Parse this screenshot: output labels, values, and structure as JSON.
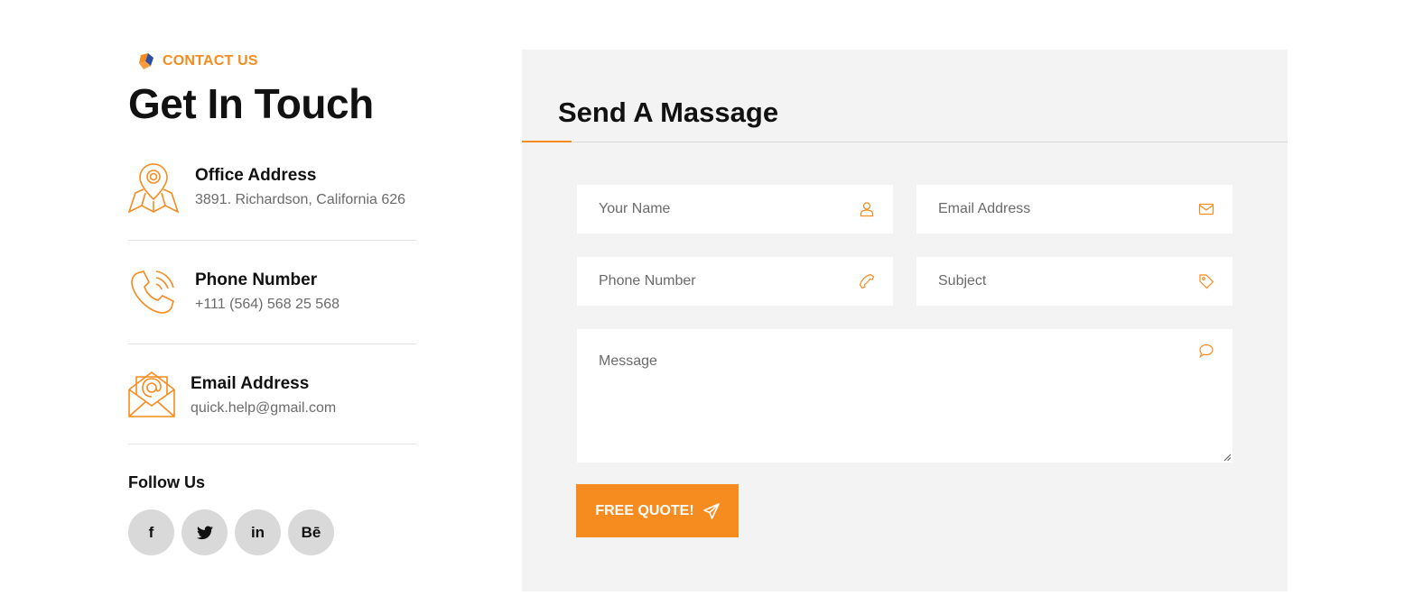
{
  "eyebrow": {
    "label": "CONTACT US",
    "icon": "brand-logo-icon"
  },
  "heading": "Get In Touch",
  "contact_items": [
    {
      "title": "Office Address",
      "value": "3891. Richardson, California 626",
      "icon": "map-pin-icon"
    },
    {
      "title": "Phone Number",
      "value": "+111 (564) 568 25 568",
      "icon": "phone-icon"
    },
    {
      "title": "Email Address",
      "value": "quick.help@gmail.com",
      "icon": "envelope-icon"
    }
  ],
  "follow": {
    "title": "Follow Us",
    "socials": [
      {
        "label": "f",
        "icon": "facebook-icon"
      },
      {
        "label": "",
        "icon": "twitter-icon"
      },
      {
        "label": "in",
        "icon": "linkedin-icon"
      },
      {
        "label": "Bē",
        "icon": "behance-icon"
      }
    ]
  },
  "form": {
    "title": "Send A Massage",
    "name_placeholder": "Your Name",
    "email_placeholder": "Email Address",
    "phone_placeholder": "Phone Number",
    "subject_placeholder": "Subject",
    "message_placeholder": "Message",
    "submit_label": "FREE QUOTE!"
  },
  "colors": {
    "accent": "#f68b1f",
    "panel_bg": "#f3f3f3",
    "social_bg": "#d9d9d9",
    "muted_text": "#6b6b6b"
  }
}
